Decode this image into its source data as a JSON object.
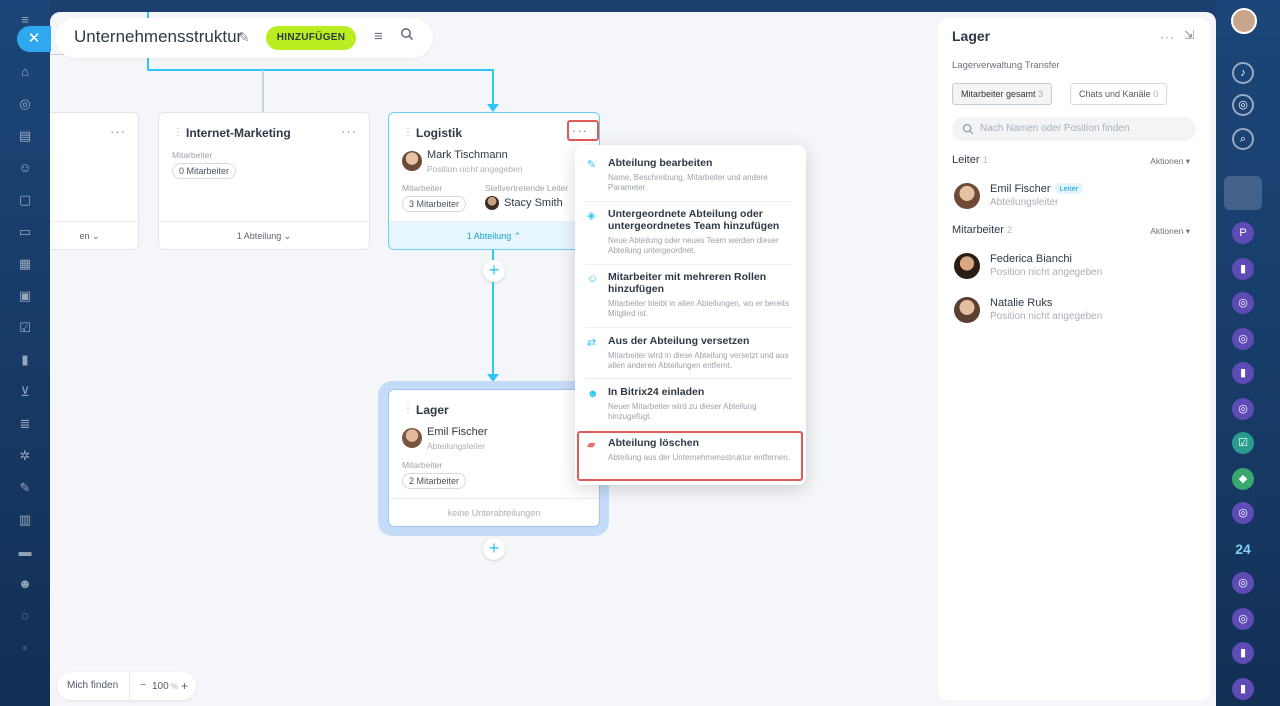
{
  "header": {
    "title": "Unternehmensstruktur",
    "add_label": "HINZUFÜGEN"
  },
  "cards": {
    "partial": {
      "footer": "en"
    },
    "internet_marketing": {
      "title": "Internet-Marketing",
      "employees_label": "Mitarbeiter",
      "employees_count": "0 Mitarbeiter",
      "footer": "1 Abteilung"
    },
    "logistik": {
      "title": "Logistik",
      "head_name": "Mark Tischmann",
      "head_position": "Position nicht angegeben",
      "employees_label": "Mitarbeiter",
      "employees_count": "3 Mitarbeiter",
      "deputy_label": "Stellvertretende Leiter",
      "deputy_name": "Stacy Smith",
      "footer": "1 Abteilung"
    },
    "lager": {
      "title": "Lager",
      "head_name": "Emil Fischer",
      "head_position": "Abteilungsleiter",
      "employees_label": "Mitarbeiter",
      "employees_count": "2 Mitarbeiter",
      "footer": "keine Unterabteilungen"
    }
  },
  "context_menu": {
    "items": [
      {
        "title": "Abteilung bearbeiten",
        "desc": "Name, Beschreibung, Mitarbeiter und andere Parameter."
      },
      {
        "title": "Untergeordnete Abteilung oder untergeordnetes Team hinzufügen",
        "desc": "Neue Abteilung oder neues Team werden dieser Abteilung untergeordnet."
      },
      {
        "title": "Mitarbeiter mit mehreren Rollen hinzufügen",
        "desc": "Mitarbeiter bleibt in allen Abteilungen, wo er bereits Mitglied ist."
      },
      {
        "title": "Aus der Abteilung versetzen",
        "desc": "Mitarbeiter wird in diese Abteilung versetzt und aus allen anderen Abteilungen entfernt."
      },
      {
        "title": "In Bitrix24 einladen",
        "desc": "Neuer Mitarbeiter wird zu dieser Abteilung hinzugefügt."
      },
      {
        "title": "Abteilung löschen",
        "desc": "Abteilung aus der Unternehmensstruktur entfernen."
      }
    ]
  },
  "zoom": {
    "find_me": "Mich finden",
    "minus": "−",
    "value": "100",
    "unit": "%",
    "plus": "+"
  },
  "panel": {
    "title": "Lager",
    "subtitle": "Lagerverwaltung Transfer",
    "tabs": [
      {
        "label": "Mitarbeiter gesamt",
        "count": "3"
      },
      {
        "label": "Chats und Kanäle",
        "count": "0"
      }
    ],
    "search_placeholder": "Nach Namen oder Position finden",
    "leaders_label": "Leiter",
    "leaders_count": "1",
    "actions_label": "Aktionen",
    "leaders": [
      {
        "name": "Emil Fischer",
        "badge": "Leiter",
        "position": "Abteilungsleiter"
      }
    ],
    "employees_label": "Mitarbeiter",
    "employees_count": "2",
    "employees": [
      {
        "name": "Federica Bianchi",
        "position": "Position nicht angegeben"
      },
      {
        "name": "Natalie Ruks",
        "position": "Position nicht angegeben"
      }
    ]
  },
  "rail": {
    "badge_24": "24",
    "p_letter": "P"
  },
  "colors": {
    "accent": "#2fc6f6",
    "add_button": "#bbed21",
    "highlight": "#e25a56",
    "delete_icon": "#f26b6b"
  }
}
